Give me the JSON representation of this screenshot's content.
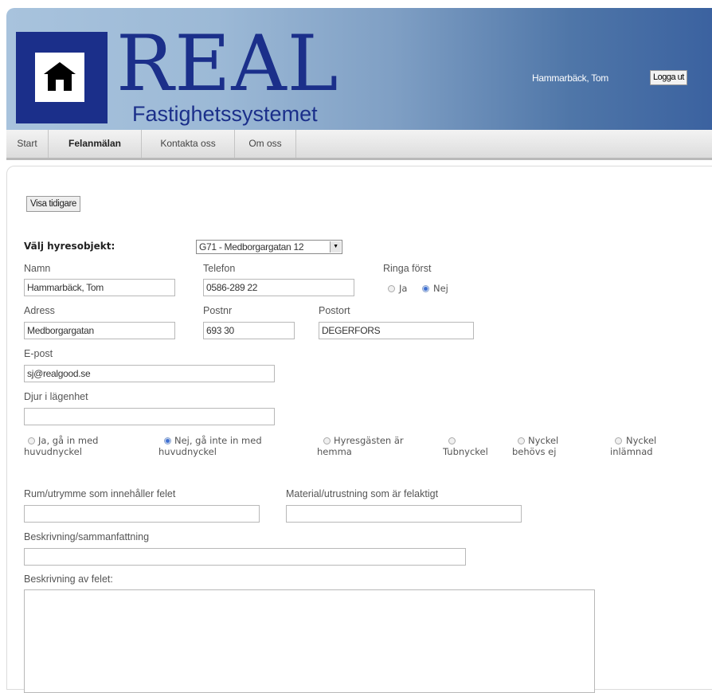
{
  "header": {
    "logo_title": "REAL",
    "logo_subtitle": "Fastighetssystemet",
    "user_name": "Hammarbäck, Tom",
    "logout_label": "Logga ut"
  },
  "nav": {
    "items": [
      "Start",
      "Felanmälan",
      "Kontakta oss",
      "Om oss"
    ],
    "active": "Felanmälan"
  },
  "form": {
    "show_previous_label": "Visa tidigare",
    "object_label": "Välj hyresobjekt:",
    "object_value": "G71 - Medborgargatan 12",
    "name_label": "Namn",
    "name_value": "Hammarbäck, Tom",
    "phone_label": "Telefon",
    "phone_value": "0586-289 22",
    "call_first_label": "Ringa först",
    "call_first_yes": "Ja",
    "call_first_no": "Nej",
    "call_first_selected": "Nej",
    "address_label": "Adress",
    "address_value": "Medborgargatan",
    "zip_label": "Postnr",
    "zip_value": "693 30",
    "city_label": "Postort",
    "city_value": "DEGERFORS",
    "email_label": "E-post",
    "email_value": "sj@realgood.se",
    "pets_label": "Djur i lägenhet",
    "pets_value": "",
    "access_options": [
      {
        "line1": "Ja, gå in med",
        "line2": "huvudnyckel",
        "selected": false
      },
      {
        "line1": "Nej, gå inte in med",
        "line2": "huvudnyckel",
        "selected": true
      },
      {
        "line1": "Hyresgästen är",
        "line2": "hemma",
        "selected": false
      },
      {
        "line1": "",
        "line2": "Tubnyckel",
        "selected": false
      },
      {
        "line1": "Nyckel",
        "line2": "behövs ej",
        "selected": false
      },
      {
        "line1": "Nyckel",
        "line2": "inlämnad",
        "selected": false
      }
    ],
    "room_label": "Rum/utrymme som innehåller felet",
    "room_value": "",
    "material_label": "Material/utrustning som är felaktigt",
    "material_value": "",
    "summary_label": "Beskrivning/sammanfattning",
    "summary_value": "",
    "description_label": "Beskrivning av felet:",
    "description_value": ""
  },
  "colors": {
    "brand_blue": "#1b2f8a",
    "header_gradient_start": "#a8c3dd",
    "header_gradient_end": "#3b62a0",
    "radio_selected": "#3e6fd1"
  },
  "icons": [
    "house-icon",
    "dropdown-arrow-icon"
  ]
}
